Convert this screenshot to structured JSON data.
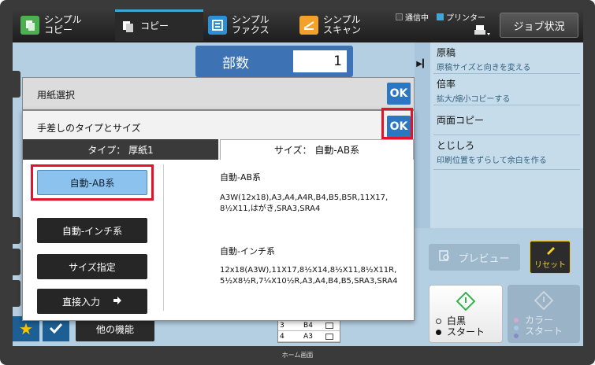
{
  "topbar": {
    "tabs": [
      {
        "label": "シンプル\nコピー",
        "icon": "simple-copy-icon",
        "color": "#4caf50"
      },
      {
        "label": "コピー",
        "icon": "copy-icon",
        "color": "#ffffff"
      },
      {
        "label": "シンプル\nファクス",
        "icon": "simple-fax-icon",
        "color": "#2d8fd8"
      },
      {
        "label": "シンプル\nスキャン",
        "icon": "simple-scan-icon",
        "color": "#f2a12a"
      }
    ],
    "status_comm": "通信中",
    "status_printer": "プリンター",
    "job_status": "ジョブ状況"
  },
  "copies": {
    "label": "部数",
    "value": "1"
  },
  "right_panel": {
    "items": [
      {
        "title": "原稿",
        "sub": "原稿サイズと向きを変える"
      },
      {
        "title": "倍率",
        "sub": "拡大/縮小コピーする"
      },
      {
        "title": "両面コピー",
        "sub": ""
      },
      {
        "title": "とじしろ",
        "sub": "印刷位置をずらして余白を作る"
      }
    ]
  },
  "dialog": {
    "paper_title": "用紙選択",
    "bypass_title": "手差しのタイプとサイズ",
    "ok": "OK",
    "tab_type": "タイプ： 厚紙1",
    "tab_size": "サイズ： 自動-AB系",
    "options": [
      "自動-AB系",
      "自動-インチ系",
      "サイズ指定",
      "直接入力"
    ],
    "info_ab_title": "自動-AB系",
    "info_ab_text": "A3W(12x18),A3,A4,A4R,B4,B5,B5R,11X17, 8½X11,はがき,SRA3,SRA4",
    "info_inch_title": "自動-インチ系",
    "info_inch_text": "12x18(A3W),11X17,8½X14,8½X11,8½X11R, 5½X8½R,7¼X10½R,A3,A4,B4,B5,SRA3,SRA4"
  },
  "bottom": {
    "other_functions": "他の機能",
    "preview": "プレビュー",
    "reset": "リセット",
    "bw_start": "白黒\nスタート",
    "color_start": "カラー\nスタート",
    "tray_rows": [
      {
        "num": "3",
        "size": "B4"
      },
      {
        "num": "4",
        "size": "A3"
      }
    ],
    "home": "ホーム画面"
  },
  "colors": {
    "accent_blue": "#2c77c1",
    "highlight_red": "#e0142a",
    "screen_bg": "#b5cfe2"
  }
}
